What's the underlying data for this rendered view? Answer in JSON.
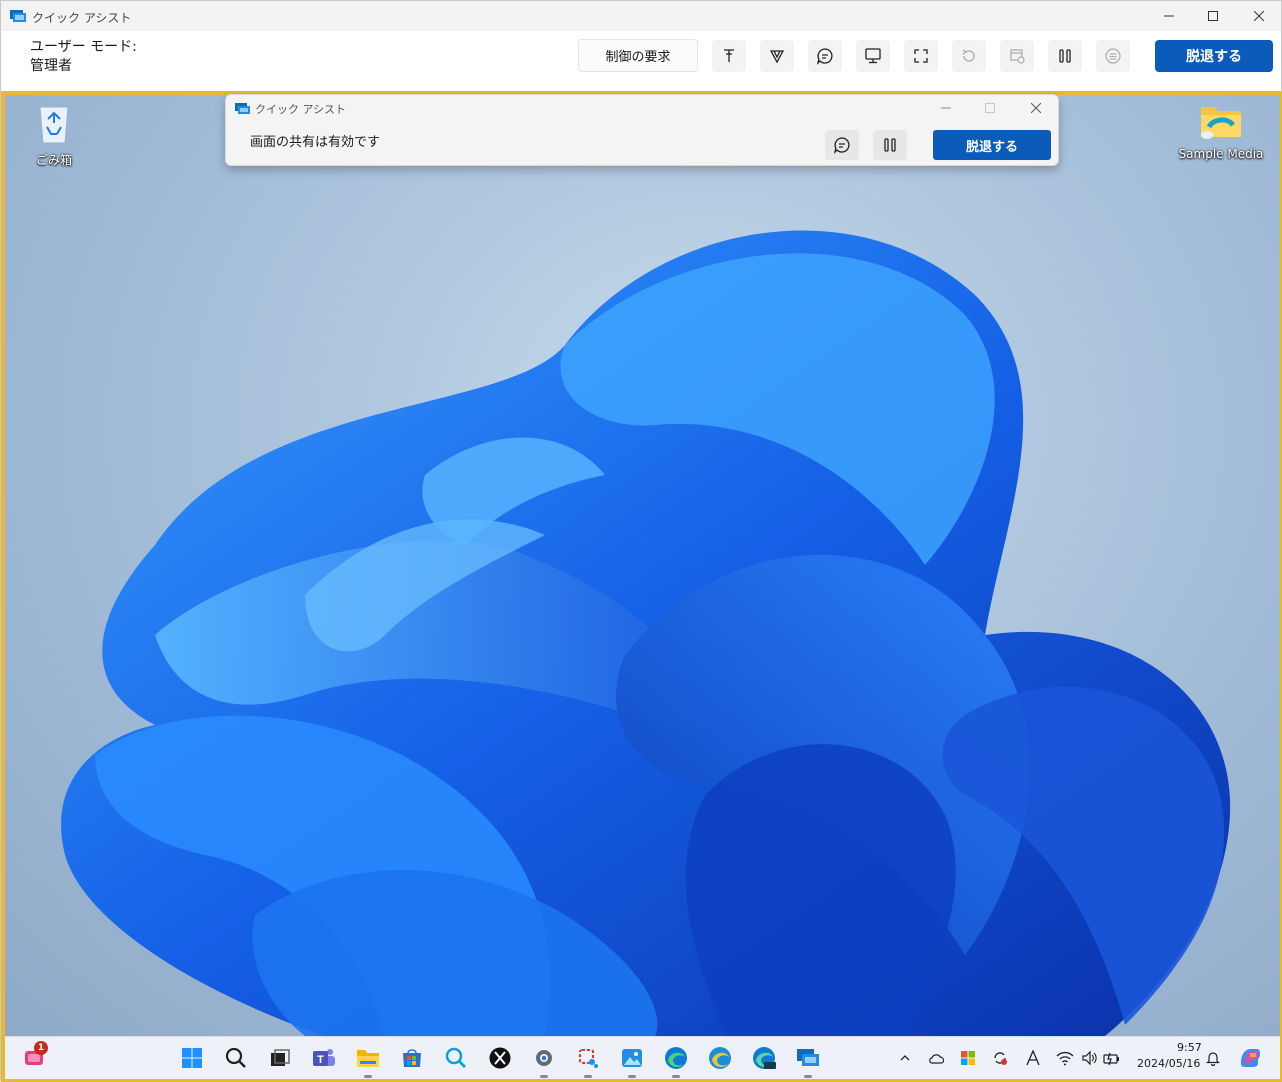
{
  "window": {
    "title": "クイック アシスト"
  },
  "toolbar": {
    "mode_label": "ユーザー モード:",
    "mode_value": "管理者",
    "request_control_label": "制御の要求",
    "leave_label": "脱退する",
    "tools": [
      "laser-pointer-icon",
      "annotate-icon",
      "chat-icon",
      "monitor-icon",
      "fullscreen-icon",
      "restart-icon",
      "task-manager-icon",
      "pause-icon",
      "more-icon"
    ]
  },
  "remote_desktop": {
    "icons": [
      {
        "name": "recycle-bin",
        "label": "ごみ箱"
      },
      {
        "name": "sample-media",
        "label": "Sample Media"
      }
    ],
    "quick_assist_bar": {
      "title": "クイック アシスト",
      "status": "画面の共有は有効です",
      "leave_label": "脱退する"
    },
    "taskbar": {
      "notification_badge": "1",
      "apps": [
        "start",
        "search",
        "task-view",
        "teams",
        "file-explorer",
        "store",
        "search-app",
        "x-app",
        "settings",
        "snipping-tool",
        "photos",
        "edge",
        "edge-beta",
        "edge-dev",
        "quick-assist"
      ],
      "tray": [
        "chevron-up",
        "onedrive",
        "windows-security",
        "sync",
        "ime",
        "wifi",
        "volume",
        "battery"
      ],
      "time": "9:57",
      "date": "2024/05/16"
    }
  },
  "colors": {
    "accent": "#0b5cba",
    "border_highlight": "#e9b92f"
  }
}
